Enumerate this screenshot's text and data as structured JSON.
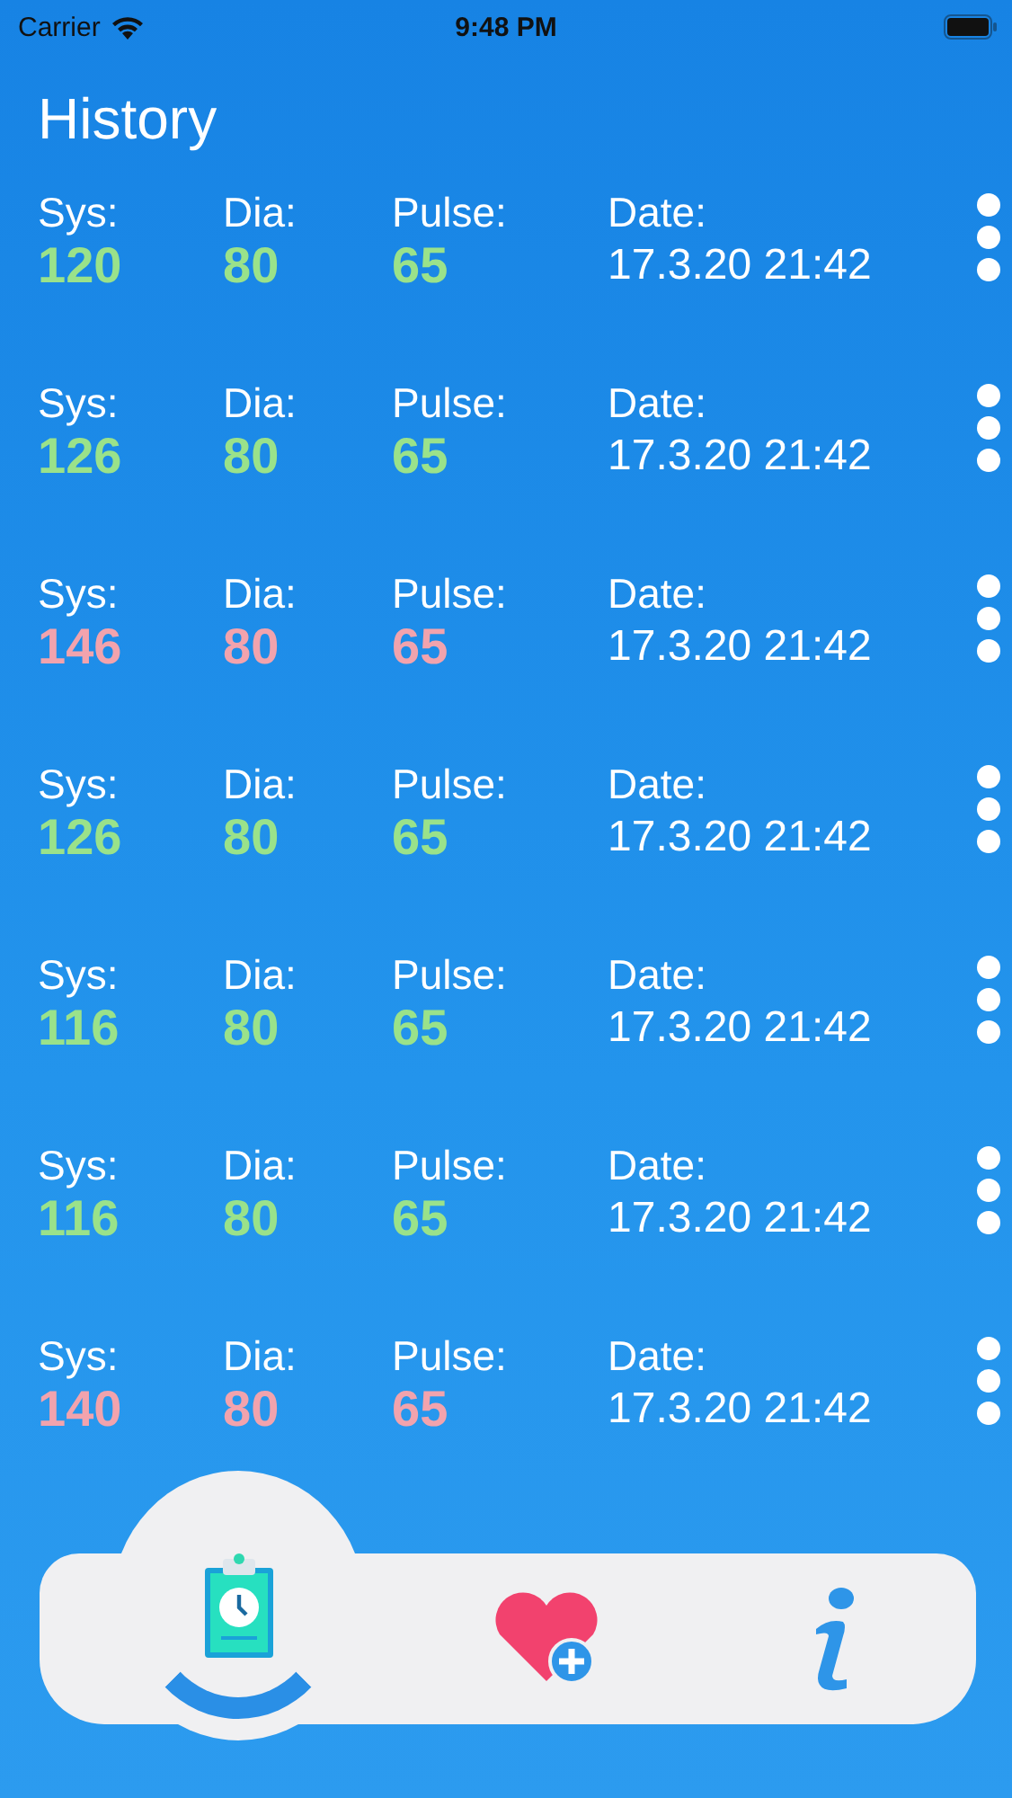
{
  "status_bar": {
    "carrier": "Carrier",
    "time": "9:48 PM"
  },
  "title": "History",
  "rows": [
    {
      "sys_label": "Sys:",
      "sys": "120",
      "dia_label": "Dia:",
      "dia": "80",
      "pulse_label": "Pulse:",
      "pulse": "65",
      "date_label": "Date:",
      "date": "17.3.20 21:42",
      "high": false
    },
    {
      "sys_label": "Sys:",
      "sys": "126",
      "dia_label": "Dia:",
      "dia": "80",
      "pulse_label": "Pulse:",
      "pulse": "65",
      "date_label": "Date:",
      "date": "17.3.20 21:42",
      "high": false
    },
    {
      "sys_label": "Sys:",
      "sys": "146",
      "dia_label": "Dia:",
      "dia": "80",
      "pulse_label": "Pulse:",
      "pulse": "65",
      "date_label": "Date:",
      "date": "17.3.20 21:42",
      "high": true
    },
    {
      "sys_label": "Sys:",
      "sys": "126",
      "dia_label": "Dia:",
      "dia": "80",
      "pulse_label": "Pulse:",
      "pulse": "65",
      "date_label": "Date:",
      "date": "17.3.20 21:42",
      "high": false
    },
    {
      "sys_label": "Sys:",
      "sys": "116",
      "dia_label": "Dia:",
      "dia": "80",
      "pulse_label": "Pulse:",
      "pulse": "65",
      "date_label": "Date:",
      "date": "17.3.20 21:42",
      "high": false
    },
    {
      "sys_label": "Sys:",
      "sys": "116",
      "dia_label": "Dia:",
      "dia": "80",
      "pulse_label": "Pulse:",
      "pulse": "65",
      "date_label": "Date:",
      "date": "17.3.20 21:42",
      "high": false
    },
    {
      "sys_label": "Sys:",
      "sys": "140",
      "dia_label": "Dia:",
      "dia": "80",
      "pulse_label": "Pulse:",
      "pulse": "65",
      "date_label": "Date:",
      "date": "17.3.20 21:42",
      "high": true
    }
  ],
  "tabs": [
    {
      "kind": "history",
      "selected": true
    },
    {
      "kind": "add",
      "selected": false
    },
    {
      "kind": "info",
      "selected": false
    }
  ]
}
